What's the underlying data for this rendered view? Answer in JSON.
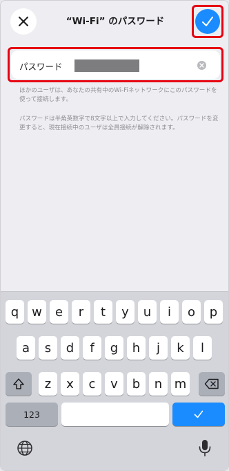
{
  "header": {
    "title": "“Wi-Fi” のパスワード",
    "close_icon": "close-icon",
    "confirm_icon": "checkmark-icon"
  },
  "password_field": {
    "label": "パスワード",
    "value_masked": true,
    "clear_icon": "clear-icon"
  },
  "notes": [
    "ほかのユーザは、あなたの共有中のWi-Fiネットワークにこのパスワードを使って接続します。",
    "パスワードは半角英数字で8文字以上で入力してください。パスワードを変更すると、現在接続中のユーザは全員接続が解除されます。"
  ],
  "keyboard": {
    "row1": [
      "q",
      "w",
      "e",
      "r",
      "t",
      "y",
      "u",
      "i",
      "o",
      "p"
    ],
    "row2": [
      "a",
      "s",
      "d",
      "f",
      "g",
      "h",
      "j",
      "k",
      "l"
    ],
    "row3": [
      "z",
      "x",
      "c",
      "v",
      "b",
      "n",
      "m"
    ],
    "shift_icon": "shift-icon",
    "delete_icon": "delete-icon",
    "numbers_label": "123",
    "space_label": "",
    "done_icon": "checkmark-icon",
    "globe_icon": "globe-icon",
    "mic_icon": "microphone-icon"
  },
  "colors": {
    "accent": "#1a8cff",
    "highlight": "#e60012"
  }
}
